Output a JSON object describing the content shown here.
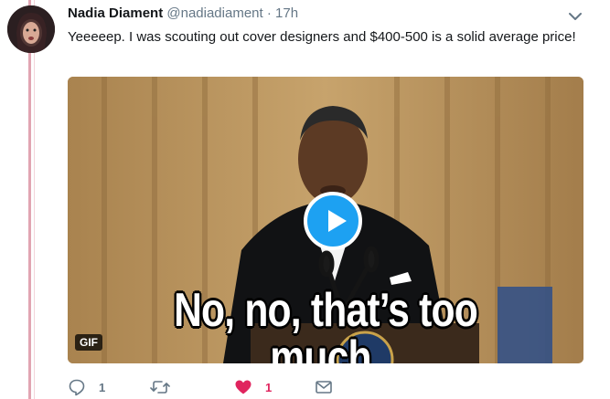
{
  "tweet": {
    "author_name": "Nadia Diament",
    "handle": "@nadiadiament",
    "separator": "·",
    "time": "17h",
    "text": "Yeeeeep. I was scouting out cover designers and $400-500 is a solid average price!",
    "media": {
      "caption": "No, no, that’s too much.",
      "badge": "GIF"
    },
    "actions": {
      "reply_count": "1",
      "retweet_count": "",
      "like_count": "1"
    }
  },
  "colors": {
    "accent": "#1da1f2",
    "like": "#e0245e",
    "thread_line": "#e1a5b2",
    "muted": "#657786"
  },
  "icons": [
    "chevron-down-icon",
    "play-icon",
    "reply-icon",
    "retweet-icon",
    "heart-icon",
    "dm-envelope-icon"
  ]
}
